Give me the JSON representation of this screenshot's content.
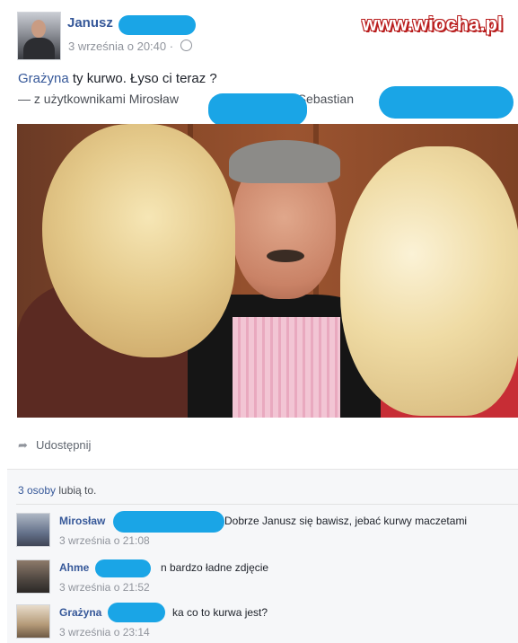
{
  "watermark": "www.wiocha.pl",
  "post": {
    "author": "Janusz",
    "timestamp": "3 września o 20:40 ·",
    "audience_icon": "globe-icon",
    "text_name": "Grażyna",
    "text_rest": " ty kurwo. Łyso ci teraz ?",
    "tagged": "— z użytkownikami Mirosław",
    "tagged_and": "i Sebastian",
    "share_label": "Udostępnij",
    "share_icon": "share-arrow-icon"
  },
  "likes": {
    "count": "3 osoby",
    "rest": " lubią to."
  },
  "comments": [
    {
      "name": "Mirosław",
      "text": "Dobrze Janusz się bawisz, jebać kurwy maczetami",
      "time": "3 września o 21:08"
    },
    {
      "name": "Ahme",
      "text": "n bardzo ładne zdjęcie",
      "time": "3 września o 21:52"
    },
    {
      "name": "Grażyna",
      "text": "ka co to kurwa jest?",
      "time": "3 września o 23:14"
    }
  ],
  "colors": {
    "link": "#365899",
    "redaction": "#1aa5e6",
    "meta": "#90949c"
  }
}
